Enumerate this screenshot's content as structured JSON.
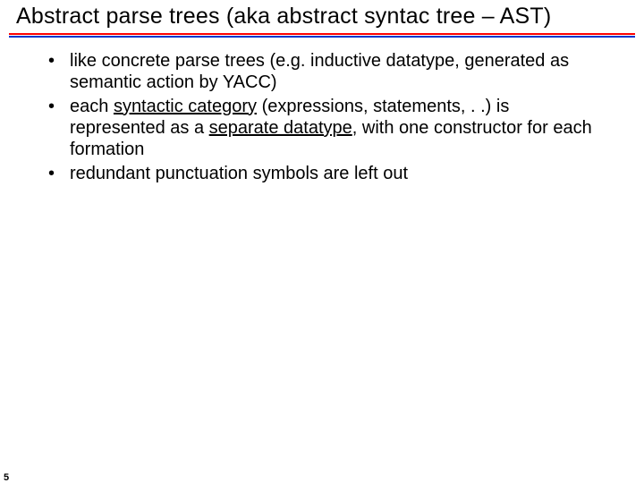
{
  "title": "Abstract parse trees (aka abstract syntac tree – AST)",
  "bullets": [
    {
      "pre": "like concrete parse trees (e.",
      "post": "g. inductive datatype, generated as",
      "line2": "semantic action by YACC)"
    },
    {
      "pre": "each ",
      "u1": "syntactic category",
      "mid": " (expressions, statements, . .) is represented as a ",
      "u2": "separate datatype",
      "post": ", with one constructor for each formation"
    },
    {
      "text": "redundant punctuation symbols are left out"
    }
  ],
  "page_number": "5"
}
